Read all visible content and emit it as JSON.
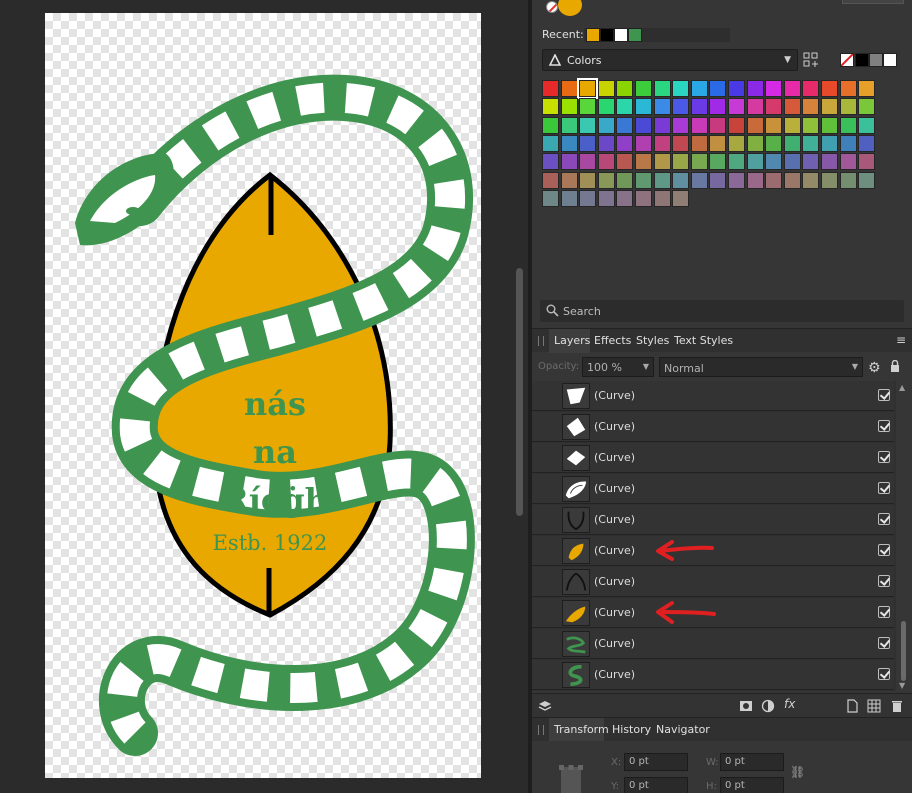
{
  "canvas": {
    "crest_line1": "nás",
    "crest_line2": "na",
    "crest_line3": "Ríoġh",
    "crest_est": "Estb. 1922"
  },
  "swatches": {
    "recent_label": "Recent:",
    "recent_colors": [
      "#e8a800",
      "#000000",
      "#ffffff",
      "#3f9450"
    ],
    "dropdown_label": "Colors",
    "mini_colors": [
      "#ffffff",
      "#000000",
      "#808080",
      "#ffffff"
    ],
    "palette_rows": [
      [
        "#e62a2a",
        "#e86a12",
        "#e8a800",
        "#c8d400",
        "#8cd400",
        "#3ccc3c",
        "#2ad680",
        "#2ad6c0",
        "#2aa8e6",
        "#2a6ae6",
        "#4a3ae6",
        "#8a2ae6",
        "#d42ae6",
        "#e62aa8",
        "#e62a6a",
        "#e64a2a",
        "#e6702a",
        "#e6a02a"
      ],
      [
        "#c8e000",
        "#9ae000",
        "#58d63a",
        "#2ad670",
        "#2ad6aa",
        "#2ab8d6",
        "#3a8ae6",
        "#4a5ae6",
        "#6a3ae6",
        "#a02ae6",
        "#c83ad6",
        "#d63aa0",
        "#d63a6a",
        "#d65a3a",
        "#d6823a",
        "#c8a83a",
        "#a8b83a",
        "#7ac83a"
      ],
      [
        "#3ac83a",
        "#3ac87a",
        "#3ac8b0",
        "#3aa8c8",
        "#3a78d6",
        "#4a4ad6",
        "#7a3ad6",
        "#a83ad6",
        "#c83ab8",
        "#c83a80",
        "#c8443a",
        "#c86a3a",
        "#c8923a",
        "#b8b03a",
        "#90c03a",
        "#60c03a",
        "#3ac05a",
        "#3ac09a"
      ],
      [
        "#3aa8b0",
        "#3a88c0",
        "#4a60c8",
        "#6a48c8",
        "#9040c8",
        "#b040b0",
        "#c04080",
        "#c04850",
        "#c06a40",
        "#c09040",
        "#a8a840",
        "#80b040",
        "#58b048",
        "#40b070",
        "#40b098",
        "#40a0b0",
        "#4080b8",
        "#5060c0"
      ],
      [
        "#6a50c0",
        "#8a48b8",
        "#a848a0",
        "#b84878",
        "#b85850",
        "#b87848",
        "#b09848",
        "#98a848",
        "#78a850",
        "#58a860",
        "#50a880",
        "#50a0a0",
        "#5088b0",
        "#5870b0",
        "#7060b0",
        "#8858a8",
        "#a05898",
        "#a85878"
      ],
      [
        "#a86058",
        "#a87858",
        "#a09058",
        "#889858",
        "#709858",
        "#609870",
        "#609888",
        "#6090a0",
        "#6878a0",
        "#7868a0",
        "#8a6898",
        "#9a6888",
        "#9a6c70",
        "#9a7868",
        "#948a68",
        "#848e68",
        "#768e70",
        "#6e8e80"
      ],
      [
        "#6e8888",
        "#6e8090",
        "#747890",
        "#7e7490",
        "#88728a",
        "#8e727e",
        "#8e7676",
        "#8e7e74"
      ]
    ],
    "search_placeholder": "Search"
  },
  "layers_panel": {
    "tabs": [
      "Layers",
      "Effects",
      "Styles",
      "Text Styles"
    ],
    "opacity_label": "Opacity:",
    "opacity_value": "100 %",
    "blend_mode": "Normal",
    "layers": [
      {
        "name": "(Curve)",
        "thumb": "white-shape-1",
        "visible": true,
        "arrow": false
      },
      {
        "name": "(Curve)",
        "thumb": "white-shape-2",
        "visible": true,
        "arrow": false
      },
      {
        "name": "(Curve)",
        "thumb": "white-shape-3",
        "visible": true,
        "arrow": false
      },
      {
        "name": "(Curve)",
        "thumb": "snake-head",
        "visible": true,
        "arrow": false
      },
      {
        "name": "(Curve)",
        "thumb": "black-outline-lower",
        "visible": true,
        "arrow": false
      },
      {
        "name": "(Curve)",
        "thumb": "gold-lower",
        "visible": true,
        "arrow": true
      },
      {
        "name": "(Curve)",
        "thumb": "black-outline-upper",
        "visible": true,
        "arrow": false
      },
      {
        "name": "(Curve)",
        "thumb": "gold-upper",
        "visible": true,
        "arrow": true
      },
      {
        "name": "(Curve)",
        "thumb": "green-body-lower",
        "visible": true,
        "arrow": false
      },
      {
        "name": "(Curve)",
        "thumb": "green-body-upper",
        "visible": true,
        "arrow": false
      }
    ]
  },
  "transform_panel": {
    "tabs": [
      "Transform",
      "History",
      "Navigator"
    ],
    "x_label": "X:",
    "x_value": "0 pt",
    "y_label": "Y:",
    "y_value": "0 pt",
    "w_label": "W:",
    "w_value": "0 pt",
    "h_label": "H:",
    "h_value": "0 pt"
  },
  "colors": {
    "accent_gold": "#e8a800",
    "accent_green": "#3f9450",
    "annotation_red": "#e02020"
  }
}
